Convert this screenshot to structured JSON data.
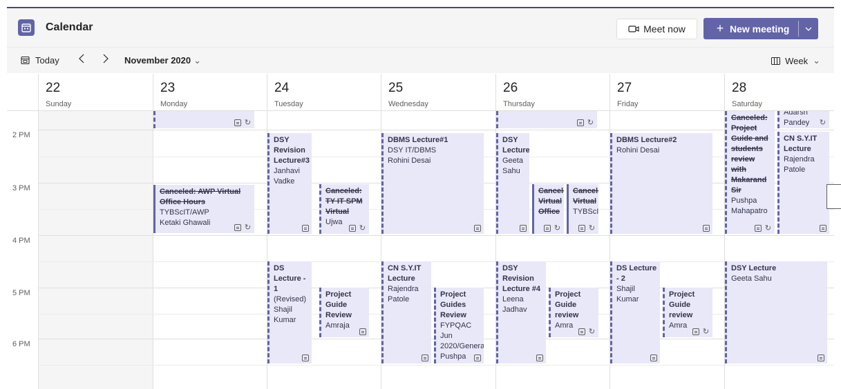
{
  "app": {
    "title": "Calendar"
  },
  "header": {
    "meet_now": "Meet now",
    "new_meeting": "New meeting"
  },
  "toolbar": {
    "today": "Today",
    "month": "November 2020",
    "view": "Week"
  },
  "days": [
    {
      "num": "22",
      "name": "Sunday"
    },
    {
      "num": "23",
      "name": "Monday"
    },
    {
      "num": "24",
      "name": "Tuesday"
    },
    {
      "num": "25",
      "name": "Wednesday"
    },
    {
      "num": "26",
      "name": "Thursday"
    },
    {
      "num": "27",
      "name": "Friday"
    },
    {
      "num": "28",
      "name": "Saturday"
    }
  ],
  "times": [
    "2 PM",
    "3 PM",
    "4 PM",
    "5 PM",
    "6 PM"
  ],
  "events": [
    {
      "title": "",
      "lines": []
    },
    {
      "title": "",
      "lines": []
    },
    {
      "title": "Canceled: AWP Virtual Office Hours",
      "lines": [
        "TYBScIT/AWP",
        "Ketaki Ghawali"
      ]
    },
    {
      "title": "DSY Revision Lecture#3",
      "lines": [
        "Janhavi Vadke"
      ]
    },
    {
      "title": "Canceled: TY IT SPM Virtual",
      "lines": [
        "Ujwa"
      ]
    },
    {
      "title": "DS Lecture - 1",
      "lines": [
        "(Revised)",
        "Shajil Kumar"
      ]
    },
    {
      "title": "Project Guide Review",
      "lines": [
        "Amraja"
      ]
    },
    {
      "title": "DBMS Lecture#1",
      "lines": [
        "DSY IT/DBMS",
        "Rohini Desai"
      ]
    },
    {
      "title": "CN S.Y.IT Lecture",
      "lines": [
        "Rajendra Patole"
      ]
    },
    {
      "title": "Project Guides Review",
      "lines": [
        "FYPQAC Jun 2020/Genera",
        "Pushpa"
      ]
    },
    {
      "title": "DSY Lecture",
      "lines": [
        "Geeta Sahu"
      ]
    },
    {
      "title": "Canceled: Virtual Office",
      "lines": []
    },
    {
      "title": "Canceled: Virtual",
      "lines": [
        "TYBScIT"
      ]
    },
    {
      "title": "DSY Revision Lecture #4",
      "lines": [
        "Leena Jadhav"
      ]
    },
    {
      "title": "Project Guide review",
      "lines": [
        "Amra"
      ]
    },
    {
      "title": "DBMS Lecture#2",
      "lines": [
        "Rohini Desai"
      ]
    },
    {
      "title": "DS Lecture - 2",
      "lines": [
        "Shajil Kumar"
      ]
    },
    {
      "title": "Project Guide review",
      "lines": [
        "Amra"
      ]
    },
    {
      "title": "Canceled: Project Guide and students review with Makarand Sir",
      "lines": [
        "Pushpa Mahapatro"
      ]
    },
    {
      "title": "",
      "lines": [
        "Adarsh Pandey"
      ]
    },
    {
      "title": "CN S.Y.IT Lecture",
      "lines": [
        "Rajendra Patole"
      ]
    },
    {
      "title": "DSY Lecture",
      "lines": [
        "Geeta Sahu"
      ]
    }
  ]
}
